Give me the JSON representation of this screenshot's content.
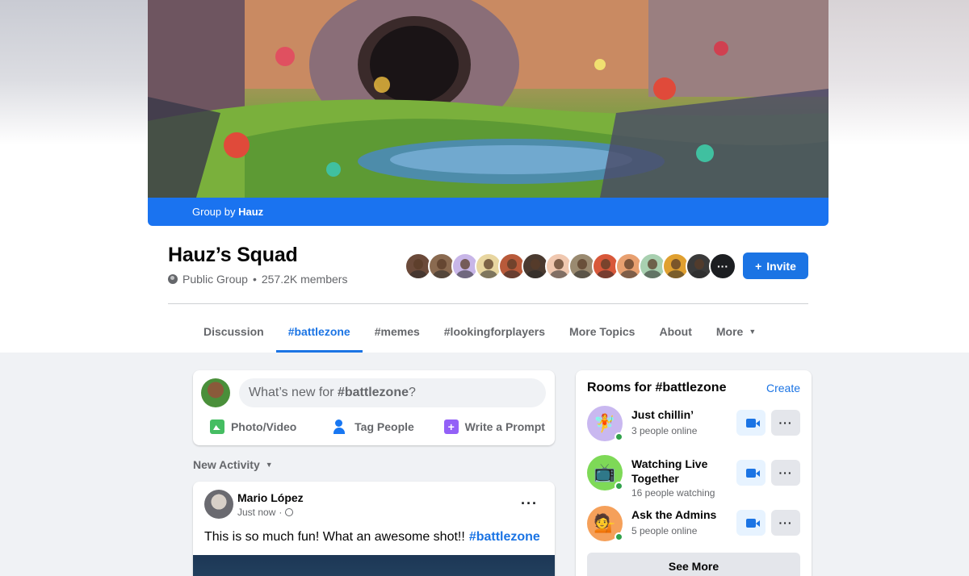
{
  "cover": {
    "group_by_prefix": "Group by",
    "group_by_name": "Hauz"
  },
  "group": {
    "name": "Hauz’s Squad",
    "privacy": "Public Group",
    "separator": "•",
    "members_count": "257.2K members",
    "members_overflow": "···",
    "invite_label": "Invite",
    "invite_icon": "+"
  },
  "tabs": [
    {
      "label": "Discussion",
      "active": false
    },
    {
      "label": "#battlezone",
      "active": true
    },
    {
      "label": "#memes",
      "active": false
    },
    {
      "label": "#lookingforplayers",
      "active": false
    },
    {
      "label": "More Topics",
      "active": false
    },
    {
      "label": "About",
      "active": false
    },
    {
      "label": "More",
      "active": false
    }
  ],
  "composer": {
    "placeholder_prefix": "What’s new for",
    "placeholder_topic": "#battlezone",
    "placeholder_suffix": "?",
    "actions": {
      "photo": "Photo/Video",
      "tag": "Tag People",
      "prompt": "Write a Prompt"
    }
  },
  "feed": {
    "sort_label": "New Activity"
  },
  "post": {
    "author": "Mario López",
    "time": "Just now",
    "separator": "·",
    "menu": "···",
    "text": "This is so much fun! What an awesome shot!!",
    "hashtag": "#battlezone"
  },
  "rooms": {
    "title": "Rooms for #battlezone",
    "create_label": "Create",
    "items": [
      {
        "name": "Just chillin’",
        "status": "3 people online",
        "emoji": "🧚",
        "bg": "#c9b8f0"
      },
      {
        "name": "Watching Live Together",
        "status": "16 people watching",
        "emoji": "📺",
        "bg": "#7ed957"
      },
      {
        "name": "Ask the Admins",
        "status": "5 people online",
        "emoji": "💁",
        "bg": "#f5a05a"
      }
    ],
    "more_label": "···",
    "see_more_label": "See More"
  },
  "colors": {
    "accent": "#1b74e4",
    "cover_bar": "#1a73f0",
    "online": "#31a24c"
  },
  "member_avatars": [
    "#6b4a3a",
    "#8a6a50",
    "#c8b6e8",
    "#e8d6a0",
    "#b85a3a",
    "#4a3a30",
    "#f0c8b0",
    "#9a8a70",
    "#d8583a",
    "#e8a070",
    "#a8d0b0",
    "#e0a030",
    "#3a3a3a"
  ]
}
